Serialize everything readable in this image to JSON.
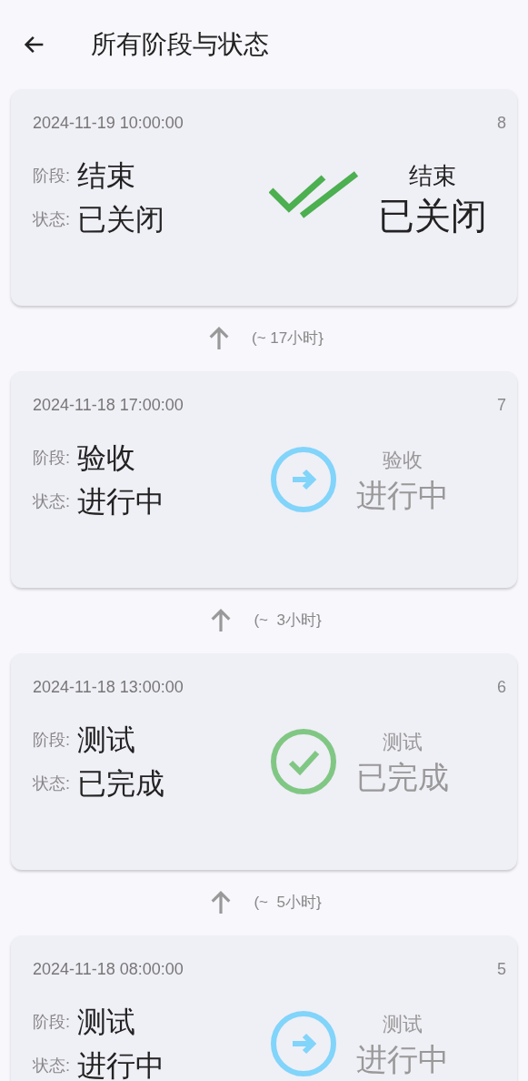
{
  "header": {
    "title": "所有阶段与状态"
  },
  "entries": [
    {
      "time": "2024-11-19 10:00:00",
      "number": "8",
      "stage_label": "阶段:",
      "stage": "结束",
      "status_label": "状态:",
      "status": "已关闭",
      "kind": "closed",
      "summary_stage": "结束",
      "summary_status": "已关闭",
      "interval": "(~ 17小时}"
    },
    {
      "time": "2024-11-18 17:00:00",
      "number": "7",
      "stage_label": "阶段:",
      "stage": "验收",
      "status_label": "状态:",
      "status": "进行中",
      "kind": "in_progress",
      "summary_stage": "验收",
      "summary_status": "进行中",
      "interval": "(~  3小时}"
    },
    {
      "time": "2024-11-18 13:00:00",
      "number": "6",
      "stage_label": "阶段:",
      "stage": "测试",
      "status_label": "状态:",
      "status": "已完成",
      "kind": "done",
      "summary_stage": "测试",
      "summary_status": "已完成",
      "interval": "(~  5小时}"
    },
    {
      "time": "2024-11-18 08:00:00",
      "number": "5",
      "stage_label": "阶段:",
      "stage": "测试",
      "status_label": "状态:",
      "status": "进行中",
      "kind": "in_progress",
      "summary_stage": "测试",
      "summary_status": "进行中"
    }
  ]
}
